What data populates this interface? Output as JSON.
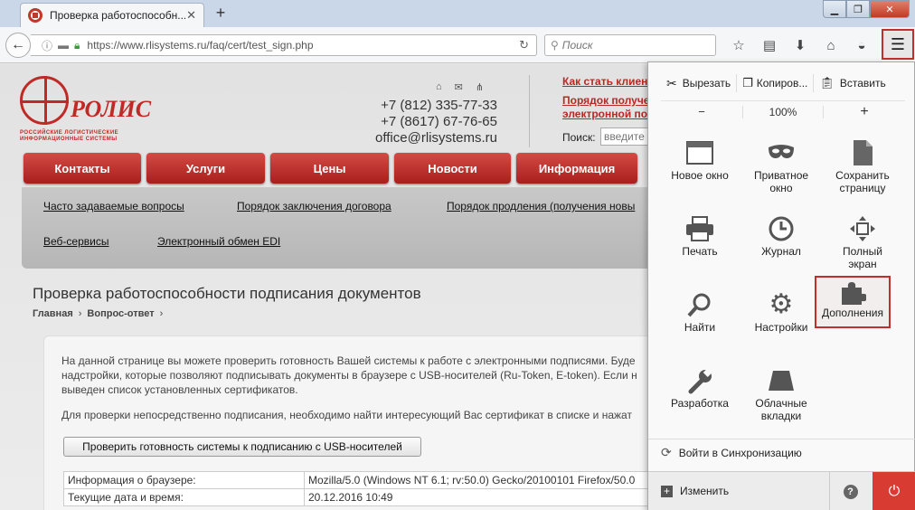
{
  "browser": {
    "tab_title": "Проверка работоспособн...",
    "tab_close": "✕",
    "new_tab": "+",
    "win_min": "▁",
    "win_max": "❐",
    "win_close": "✕",
    "url": "https://www.rlisystems.ru/faq/cert/test_sign.php",
    "search_placeholder": "Поиск"
  },
  "site": {
    "logo_name": "РОЛИС",
    "logo_sub1": "РОССИЙСКИЕ ЛОГИСТИЧЕСКИЕ",
    "logo_sub2": "ИНФОРМАЦИОННЫЕ СИСТЕМЫ",
    "phone1": "+7 (812) 335-77-33",
    "phone2": "+7 (8617) 67-76-65",
    "email": "office@rlisystems.ru",
    "top_link1": "Как стать клиен",
    "top_link2a": "Порядок получе",
    "top_link2b": "электронной по",
    "search_label": "Поиск:",
    "search_placeholder": "введите",
    "nav": [
      "Контакты",
      "Услуги",
      "Цены",
      "Новости",
      "Информация"
    ],
    "subnav": [
      "Часто задаваемые вопросы",
      "Порядок заключения договора",
      "Порядок продления (получения новы",
      "Веб-сервисы",
      "Электронный обмен EDI"
    ],
    "page_title": "Проверка работоспособности подписания документов",
    "crumb1": "Главная",
    "crumb2": "Вопрос-ответ",
    "crumb_sep": "›",
    "para1a": "На данной странице вы можете проверить готовность Вашей системы к работе с электронными подписями. Буде",
    "para1b": "надстройки, которые позволяют подписывать документы в браузере с USB-носителей (Ru-Token, E-token). Если н",
    "para1c": "выведен список установленных сертификатов.",
    "para2": "Для проверки непосредственно подписания, необходимо найти интересующий Вас сертификат в списке и нажат",
    "check_button": "Проверить готовность системы к подписанию с USB-носителей",
    "table": [
      [
        "Информация о браузере:",
        "Mozilla/5.0 (Windows NT 6.1; rv:50.0) Gecko/20100101 Firefox/50.0"
      ],
      [
        "Текущие дата и время:",
        "20.12.2016 10:49"
      ]
    ]
  },
  "menu": {
    "cut": "Вырезать",
    "copy": "Копиров...",
    "paste": "Вставить",
    "zoom_out": "−",
    "zoom_level": "100%",
    "zoom_in": "+",
    "items": [
      [
        "Новое окно",
        ""
      ],
      [
        "Приватное",
        "окно"
      ],
      [
        "Сохранить",
        "страницу"
      ],
      [
        "Печать",
        ""
      ],
      [
        "Журнал",
        ""
      ],
      [
        "Полный",
        "экран"
      ],
      [
        "Найти",
        ""
      ],
      [
        "Настройки",
        ""
      ],
      [
        "Дополнения",
        ""
      ],
      [
        "Разработка",
        ""
      ],
      [
        "Облачные",
        "вкладки"
      ]
    ],
    "sync": "Войти в Синхронизацию",
    "customize": "Изменить",
    "help": "?",
    "quit": "⏻"
  },
  "colors": {
    "brand_red": "#bf2a26",
    "highlight": "#c0302a",
    "quit": "#d73b31"
  }
}
